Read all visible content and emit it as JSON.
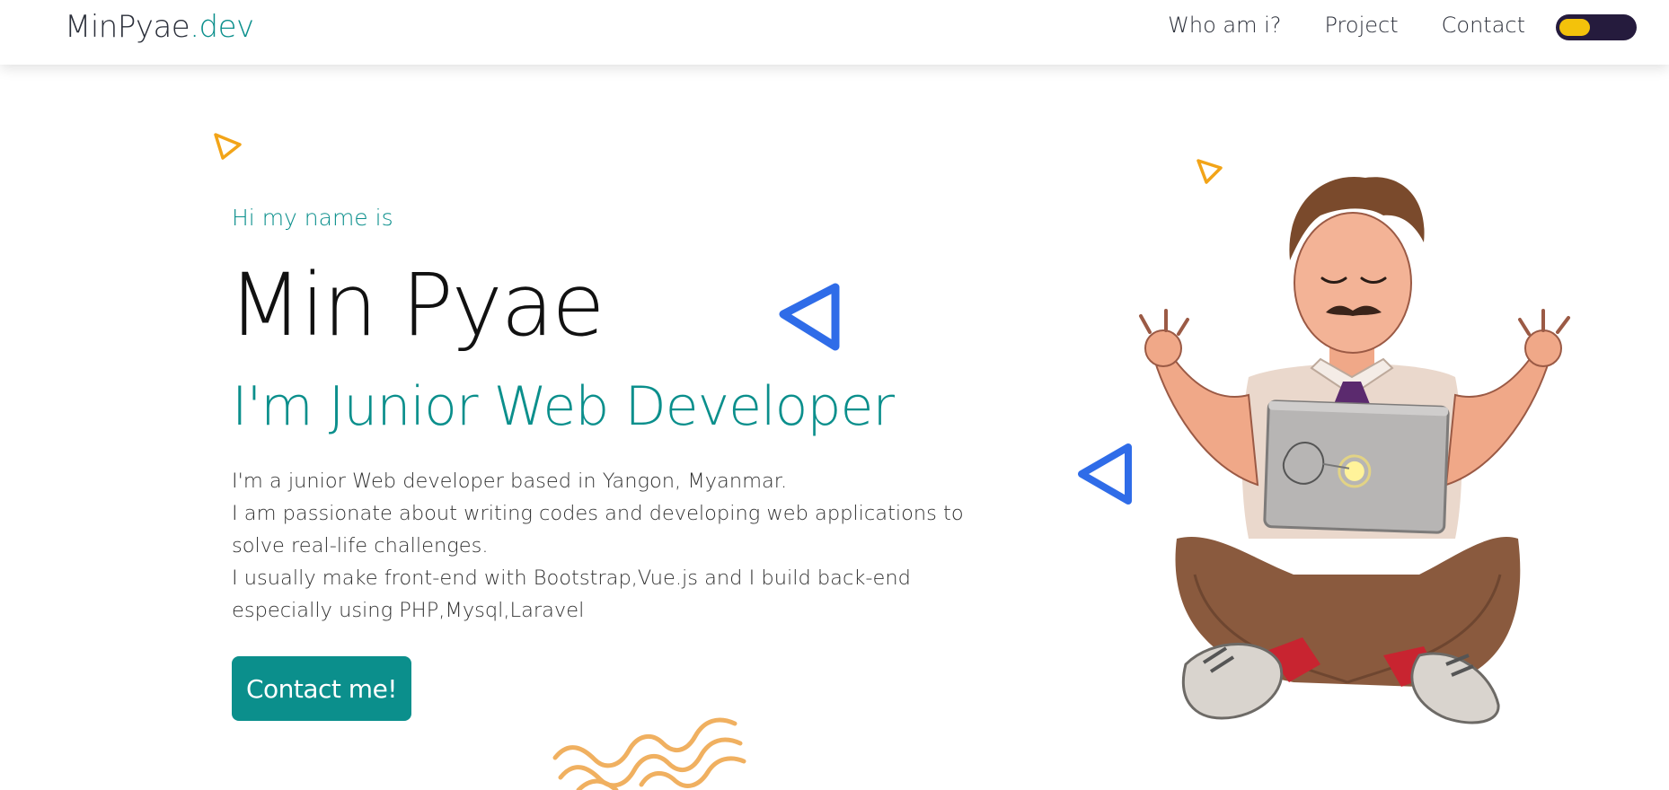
{
  "brand": {
    "name_main": "MinPyae",
    "name_accent": ".dev"
  },
  "nav": {
    "items": [
      "Who am i?",
      "Project",
      "Contact"
    ],
    "theme_toggle": "dark-mode-toggle"
  },
  "hero": {
    "greeting": "Hi my name is",
    "name": "Min Pyae",
    "role": "I'm Junior Web Developer",
    "description": [
      "I'm a junior Web developer based in Yangon, Myanmar.",
      "I am passionate about writing codes and developing web applications to solve real-life challenges.",
      "I usually make front-end with Bootstrap,Vue.js and I build back-end especially using PHP,Mysql,Laravel"
    ],
    "cta_label": "Contact me!"
  },
  "colors": {
    "accent": "#0b8f8c",
    "toggle_bg": "#251b3d",
    "toggle_knob": "#f3c20b",
    "triangle_blue": "#2f6ce8",
    "triangle_orange": "#f2a418",
    "squiggle_orange": "#f0b060"
  },
  "illustration": {
    "subject": "developer-meditating-with-laptop"
  }
}
